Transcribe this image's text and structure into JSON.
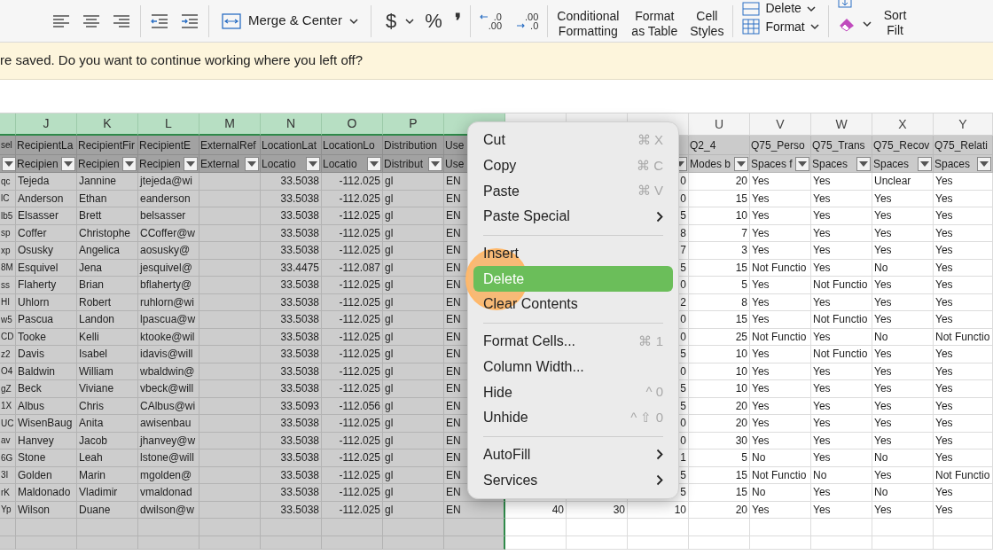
{
  "toolbar": {
    "merge_label": "Merge & Center",
    "currency": "$",
    "percent": "%",
    "comma": "❜",
    "decimal_decrease": {
      "top": ".0",
      "bottom": ".00"
    },
    "decimal_increase": {
      "top": ".00",
      "bottom": ".0"
    },
    "styles": [
      {
        "line1": "Conditional",
        "line2": "Formatting"
      },
      {
        "line1": "Format",
        "line2": "as Table"
      },
      {
        "line1": "Cell",
        "line2": "Styles"
      }
    ],
    "cells_group": {
      "top": "Delete",
      "bottom": "Format"
    },
    "sort": {
      "line1": "Sort",
      "line2": "Filt"
    }
  },
  "message_bar": {
    "text": "re saved. Do you want to continue working where you left off?"
  },
  "columns": [
    {
      "selected": true,
      "filter": true
    },
    {
      "letter": "J",
      "selected": true,
      "filter": true
    },
    {
      "letter": "K",
      "selected": true,
      "filter": true
    },
    {
      "letter": "L",
      "selected": true,
      "filter": true
    },
    {
      "letter": "M",
      "selected": true,
      "filter": true
    },
    {
      "letter": "N",
      "selected": true,
      "filter": true
    },
    {
      "letter": "O",
      "selected": true,
      "filter": true
    },
    {
      "letter": "P",
      "selected": true,
      "filter": true
    },
    {
      "selected": true
    },
    {
      "selected": false
    },
    {
      "selected": false
    },
    {
      "selected": false,
      "filter": true
    },
    {
      "letter": "U",
      "selected": false,
      "filter": true
    },
    {
      "letter": "V",
      "selected": false,
      "filter": true
    },
    {
      "letter": "W",
      "selected": false,
      "filter": true
    },
    {
      "letter": "X",
      "selected": false,
      "filter": true
    },
    {
      "letter": "Y",
      "selected": false,
      "filter": true
    }
  ],
  "header_rows": [
    [
      "sel",
      "RecipientLa",
      "RecipientFir",
      "RecipientE",
      "ExternalRef",
      "LocationLat",
      "LocationLo",
      "Distribution",
      "Use",
      null,
      null,
      null,
      "Q2_4",
      "Q75_Perso",
      "Q75_Trans",
      "Q75_Recov",
      "Q75_Relati"
    ],
    [
      null,
      "Recipien",
      "Recipien",
      "Recipien",
      "External",
      "Locatio",
      "Locatio",
      "Distribut",
      "Use",
      null,
      null,
      null,
      "Modes b",
      "Spaces f",
      "Spaces",
      "Spaces",
      "Spaces"
    ]
  ],
  "rows": [
    [
      "qc",
      "Tejeda",
      "Jannine",
      "jtejeda@wi",
      null,
      "33.5038",
      "-112.025",
      "gl",
      "EN",
      null,
      null,
      "0",
      "20",
      "Yes",
      "Yes",
      "Unclear",
      "Yes"
    ],
    [
      "lC",
      "Anderson",
      "Ethan",
      "eanderson",
      null,
      "33.5038",
      "-112.025",
      "gl",
      "EN",
      null,
      null,
      "0",
      "15",
      "Yes",
      "Yes",
      "Yes",
      "Yes"
    ],
    [
      "lb5",
      "Elsasser",
      "Brett",
      "belsasser",
      null,
      "33.5038",
      "-112.025",
      "gl",
      "EN",
      null,
      null,
      "5",
      "10",
      "Yes",
      "Yes",
      "Yes",
      "Yes"
    ],
    [
      "sp",
      "Coffer",
      "Christophe",
      "CCoffer@w",
      null,
      "33.5038",
      "-112.025",
      "gl",
      "EN",
      null,
      null,
      "8",
      "7",
      "Yes",
      "Yes",
      "Yes",
      "Yes"
    ],
    [
      "xp",
      "Osusky",
      "Angelica",
      "aosusky@",
      null,
      "33.5038",
      "-112.025",
      "gl",
      "EN",
      null,
      null,
      "7",
      "3",
      "Yes",
      "Yes",
      "Yes",
      "Yes"
    ],
    [
      "8M",
      "Esquivel",
      "Jena",
      "jesquivel@",
      null,
      "33.4475",
      "-112.087",
      "gl",
      "EN",
      null,
      null,
      "5",
      "15",
      "Not Functio",
      "Yes",
      "No",
      "Yes"
    ],
    [
      "ss",
      "Flaherty",
      "Brian",
      "bflaherty@",
      null,
      "33.5038",
      "-112.025",
      "gl",
      "EN",
      null,
      null,
      "0",
      "5",
      "Yes",
      "Not Functio",
      "Yes",
      "Yes"
    ],
    [
      "HI",
      "Uhlorn",
      "Robert",
      "ruhlorn@wi",
      null,
      "33.5038",
      "-112.025",
      "gl",
      "EN",
      null,
      null,
      "2",
      "8",
      "Yes",
      "Yes",
      "Yes",
      "Yes"
    ],
    [
      "w5",
      "Pascua",
      "Landon",
      "lpascua@w",
      null,
      "33.5038",
      "-112.025",
      "gl",
      "EN",
      null,
      null,
      "0",
      "15",
      "Yes",
      "Not Functio",
      "Yes",
      "Yes"
    ],
    [
      "CD",
      "Tooke",
      "Kelli",
      "ktooke@wil",
      null,
      "33.5038",
      "-112.025",
      "gl",
      "EN",
      null,
      null,
      "0",
      "25",
      "Not Functio",
      "Yes",
      "No",
      "Not Functio"
    ],
    [
      "z2",
      "Davis",
      "Isabel",
      "idavis@will",
      null,
      "33.5038",
      "-112.025",
      "gl",
      "EN",
      null,
      null,
      "5",
      "10",
      "Yes",
      "Not Functio",
      "Yes",
      "Yes"
    ],
    [
      "O4",
      "Baldwin",
      "William",
      "wbaldwin@",
      null,
      "33.5038",
      "-112.025",
      "gl",
      "EN",
      null,
      null,
      "0",
      "10",
      "Yes",
      "Yes",
      "Yes",
      "Yes"
    ],
    [
      "gZ",
      "Beck",
      "Viviane",
      "vbeck@will",
      null,
      "33.5038",
      "-112.025",
      "gl",
      "EN",
      null,
      null,
      "5",
      "10",
      "Yes",
      "Yes",
      "Yes",
      "Yes"
    ],
    [
      "1X",
      "Albus",
      "Chris",
      "CAlbus@wi",
      null,
      "33.5093",
      "-112.056",
      "gl",
      "EN",
      null,
      null,
      "5",
      "20",
      "Yes",
      "Yes",
      "Yes",
      "Yes"
    ],
    [
      "UC",
      "WisenBaug",
      "Anita",
      "awisenbau",
      null,
      "33.5038",
      "-112.025",
      "gl",
      "EN",
      null,
      null,
      "0",
      "20",
      "Yes",
      "Yes",
      "Yes",
      "Yes"
    ],
    [
      "av",
      "Hanvey",
      "Jacob",
      "jhanvey@w",
      null,
      "33.5038",
      "-112.025",
      "gl",
      "EN",
      null,
      null,
      "0",
      "30",
      "Yes",
      "Yes",
      "Yes",
      "Yes"
    ],
    [
      "6G",
      "Stone",
      "Leah",
      "lstone@will",
      null,
      "33.5038",
      "-112.025",
      "gl",
      "EN",
      null,
      null,
      "1",
      "5",
      "No",
      "Yes",
      "No",
      "Yes"
    ],
    [
      "3I",
      "Golden",
      "Marin",
      "mgolden@",
      null,
      "33.5038",
      "-112.025",
      "gl",
      "EN",
      null,
      null,
      "5",
      "15",
      "Not Functio",
      "No",
      "Yes",
      "Not Functio"
    ],
    [
      "rK",
      "Maldonado",
      "Vladimir",
      "vmaldonad",
      null,
      "33.5038",
      "-112.025",
      "gl",
      "EN",
      null,
      null,
      "5",
      "15",
      "No",
      "Yes",
      "No",
      "Yes"
    ],
    [
      "Yp",
      "Wilson",
      "Duane",
      "dwilson@w",
      null,
      "33.5038",
      "-112.025",
      "gl",
      "EN",
      "40",
      "30",
      "10",
      "20",
      "Yes",
      "Yes",
      "Yes",
      "Yes"
    ]
  ],
  "context_menu": {
    "click_marker": true,
    "items": [
      {
        "kind": "item",
        "label": "Cut",
        "shortcut": "⌘ X",
        "submenu": false,
        "selected": false
      },
      {
        "kind": "item",
        "label": "Copy",
        "shortcut": "⌘ C",
        "submenu": false,
        "selected": false
      },
      {
        "kind": "item",
        "label": "Paste",
        "shortcut": "⌘ V",
        "submenu": false,
        "selected": false
      },
      {
        "kind": "item",
        "label": "Paste Special",
        "submenu": true,
        "selected": false
      },
      {
        "kind": "separator"
      },
      {
        "kind": "item",
        "label": "Insert",
        "submenu": false,
        "selected": false
      },
      {
        "kind": "item",
        "label": "Delete",
        "submenu": false,
        "selected": true
      },
      {
        "kind": "item",
        "label": "Clear Contents",
        "submenu": false,
        "selected": false
      },
      {
        "kind": "separator"
      },
      {
        "kind": "item",
        "label": "Format Cells...",
        "shortcut": "⌘ 1",
        "submenu": false,
        "selected": false
      },
      {
        "kind": "item",
        "label": "Column Width...",
        "submenu": false,
        "selected": false
      },
      {
        "kind": "item",
        "label": "Hide",
        "shortcut": "^ 0",
        "submenu": false,
        "selected": false
      },
      {
        "kind": "item",
        "label": "Unhide",
        "shortcut": "^ ⇧ 0",
        "submenu": false,
        "selected": false
      },
      {
        "kind": "separator"
      },
      {
        "kind": "item",
        "label": "AutoFill",
        "submenu": true,
        "selected": false
      },
      {
        "kind": "item",
        "label": "Services",
        "submenu": true,
        "selected": false
      }
    ]
  }
}
